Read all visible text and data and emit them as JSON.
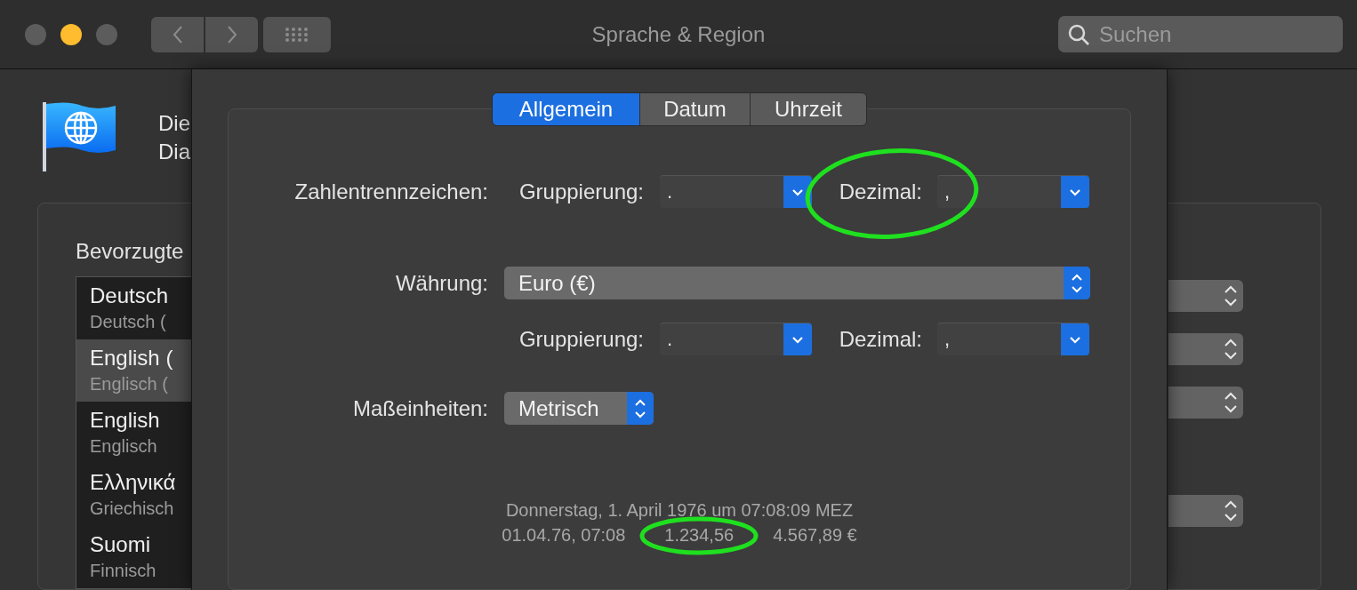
{
  "window": {
    "title": "Sprache & Region",
    "controls": [
      {
        "kind": "close",
        "enabled": false
      },
      {
        "kind": "minimize",
        "enabled": true
      },
      {
        "kind": "zoom",
        "enabled": false
      }
    ]
  },
  "search": {
    "placeholder": "Suchen"
  },
  "background": {
    "header_lines": [
      "Die",
      "Dia"
    ],
    "section_label": "Bevorzugte",
    "languages": [
      {
        "name": "Deutsch",
        "subtitle": "Deutsch (",
        "selected": false
      },
      {
        "name": "English (",
        "subtitle": "Englisch (",
        "selected": true
      },
      {
        "name": "English",
        "subtitle": "Englisch",
        "selected": false
      },
      {
        "name": "Ελληνικά",
        "subtitle": "Griechisch",
        "selected": false
      },
      {
        "name": "Suomi",
        "subtitle": "Finnisch",
        "selected": false
      }
    ]
  },
  "sheet": {
    "tabs": [
      {
        "label": "Allgemein",
        "selected": true
      },
      {
        "label": "Datum",
        "selected": false
      },
      {
        "label": "Uhrzeit",
        "selected": false
      }
    ],
    "number_separators": {
      "label": "Zahlentrennzeichen:",
      "grouping_label": "Gruppierung:",
      "grouping_value": ".",
      "decimal_label": "Dezimal:",
      "decimal_value": ","
    },
    "currency": {
      "label": "Währung:",
      "value": "Euro (€)",
      "grouping_label": "Gruppierung:",
      "grouping_value": ".",
      "decimal_label": "Dezimal:",
      "decimal_value": ","
    },
    "units": {
      "label": "Maßeinheiten:",
      "value": "Metrisch"
    },
    "sample": {
      "date_long": "Donnerstag, 1. April 1976 um 07:08:09 MEZ",
      "date_short": "01.04.76, 07:08",
      "number": "1.234,56",
      "amount": "4.567,89 €"
    }
  }
}
